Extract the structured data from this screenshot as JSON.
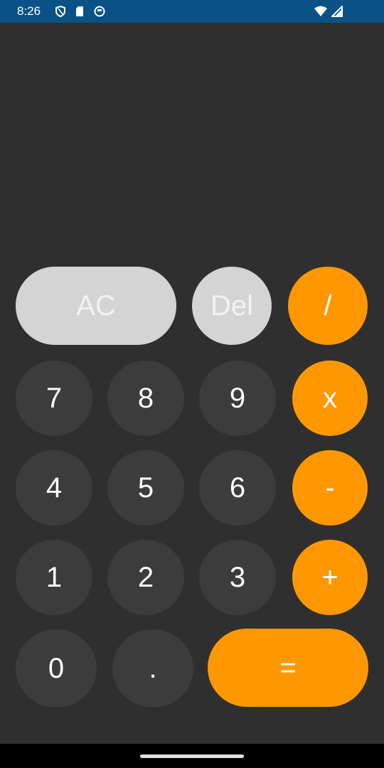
{
  "status_bar": {
    "time": "8:26",
    "icons_left": [
      "shield-icon",
      "sd-card-icon",
      "app-notification-icon"
    ],
    "icons_right": [
      "wifi-icon",
      "signal-icon"
    ],
    "background": "#0a5286"
  },
  "display": {
    "value": ""
  },
  "keypad": {
    "ac": "AC",
    "del": "Del",
    "divide": "/",
    "multiply": "x",
    "subtract": "-",
    "add": "+",
    "equals": "=",
    "dot": ".",
    "n0": "0",
    "n1": "1",
    "n2": "2",
    "n3": "3",
    "n4": "4",
    "n5": "5",
    "n6": "6",
    "n7": "7",
    "n8": "8",
    "n9": "9"
  },
  "colors": {
    "app_background": "#2f2f2f",
    "number_button": "#3c3c3c",
    "function_button": "#d4d4d4",
    "operator_button": "#ff9800",
    "text": "#ffffff"
  }
}
